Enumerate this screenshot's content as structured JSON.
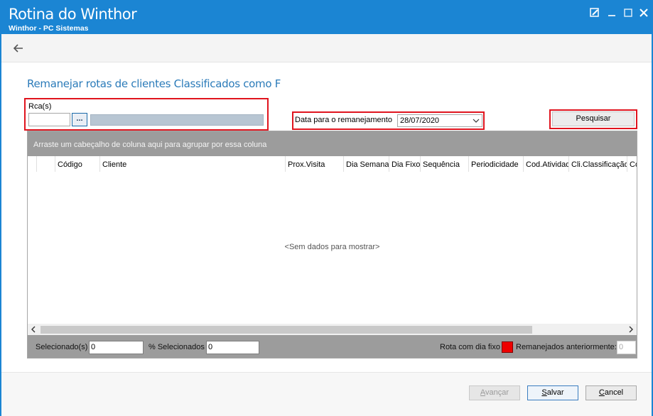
{
  "window": {
    "title": "Rotina do Winthor",
    "subtitle": "Winthor - PC Sistemas"
  },
  "page": {
    "heading": "Remanejar rotas de clientes Classificados como F"
  },
  "filters": {
    "rca_label": "Rca(s)",
    "rca_code_value": "",
    "rca_lookup_label": "...",
    "rca_name_value": "",
    "date_label": "Data para o remanejamento",
    "date_value": "28/07/2020",
    "search_button": "Pesquisar"
  },
  "grid": {
    "group_hint": "Arraste um cabeçalho de coluna aqui para agrupar por essa coluna",
    "columns": [
      "Código",
      "Cliente",
      "Prox.Visita",
      "Dia Semana",
      "Dia Fixo",
      "Sequência",
      "Periodicidade",
      "Cod.Atividade",
      "Cli.Classificação",
      "Co"
    ],
    "empty_text": "<Sem dados para mostrar>"
  },
  "footer": {
    "selected_label": "Selecionado(s)",
    "selected_value": "0",
    "pct_label": "% Selecionados",
    "pct_value": "0",
    "fixed_day_label": "Rota com dia fixo",
    "reassigned_label": "Remanejados anteriormente:",
    "reassigned_value": "0",
    "fixed_day_color": "#ee0000"
  },
  "actions": {
    "advance": "Avançar",
    "save": "Salvar",
    "cancel": "Cancel"
  },
  "colors": {
    "titlebar": "#1b85d3",
    "heading": "#2b7bb9",
    "highlight": "#e0141e"
  }
}
